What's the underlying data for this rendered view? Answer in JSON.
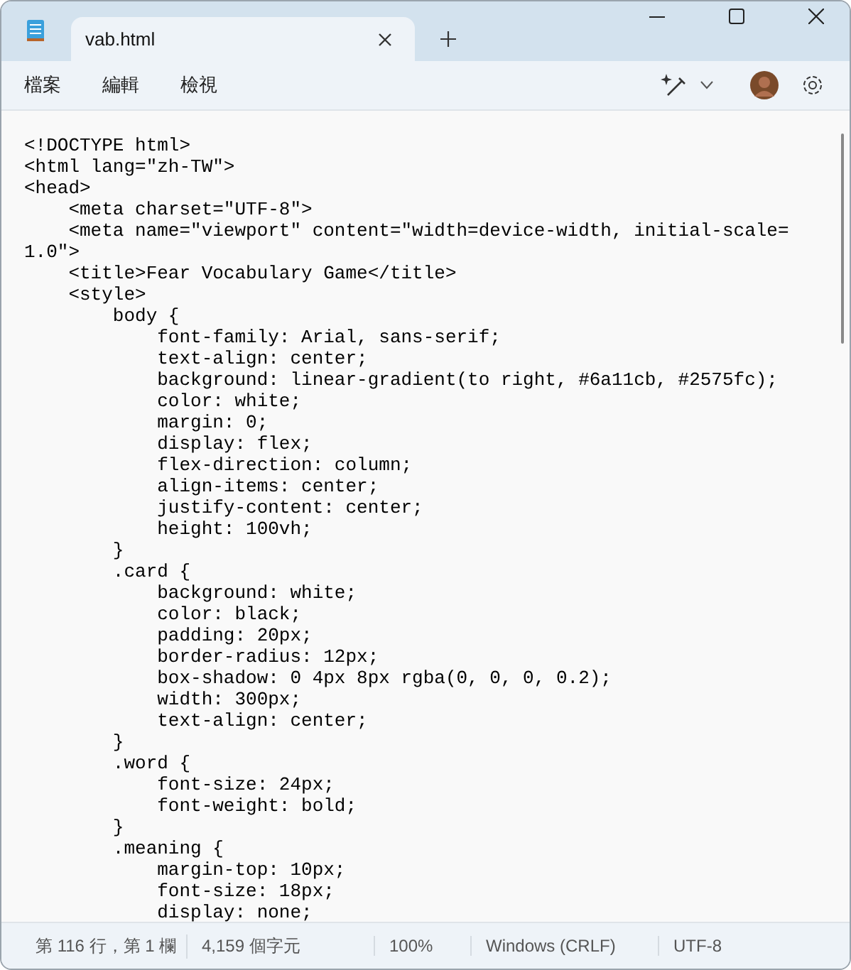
{
  "tab": {
    "title": "vab.html",
    "selected": true
  },
  "menu": [
    "檔案",
    "編輯",
    "檢視"
  ],
  "editor_lines": [
    "<!DOCTYPE html>",
    "<html lang=\"zh-TW\">",
    "<head>",
    "    <meta charset=\"UTF-8\">",
    "    <meta name=\"viewport\" content=\"width=device-width, initial-scale=",
    "1.0\">",
    "    <title>Fear Vocabulary Game</title>",
    "    <style>",
    "        body {",
    "            font-family: Arial, sans-serif;",
    "            text-align: center;",
    "            background: linear-gradient(to right, #6a11cb, #2575fc);",
    "            color: white;",
    "            margin: 0;",
    "            display: flex;",
    "            flex-direction: column;",
    "            align-items: center;",
    "            justify-content: center;",
    "            height: 100vh;",
    "        }",
    "        .card {",
    "            background: white;",
    "            color: black;",
    "            padding: 20px;",
    "            border-radius: 12px;",
    "            box-shadow: 0 4px 8px rgba(0, 0, 0, 0.2);",
    "            width: 300px;",
    "            text-align: center;",
    "        }",
    "        .word {",
    "            font-size: 24px;",
    "            font-weight: bold;",
    "        }",
    "        .meaning {",
    "            margin-top: 10px;",
    "            font-size: 18px;",
    "            display: none;"
  ],
  "status_bar": [
    "第 116 行，第 1 欄",
    "4,159 個字元",
    "100%",
    "Windows (CRLF)",
    "UTF-8"
  ]
}
